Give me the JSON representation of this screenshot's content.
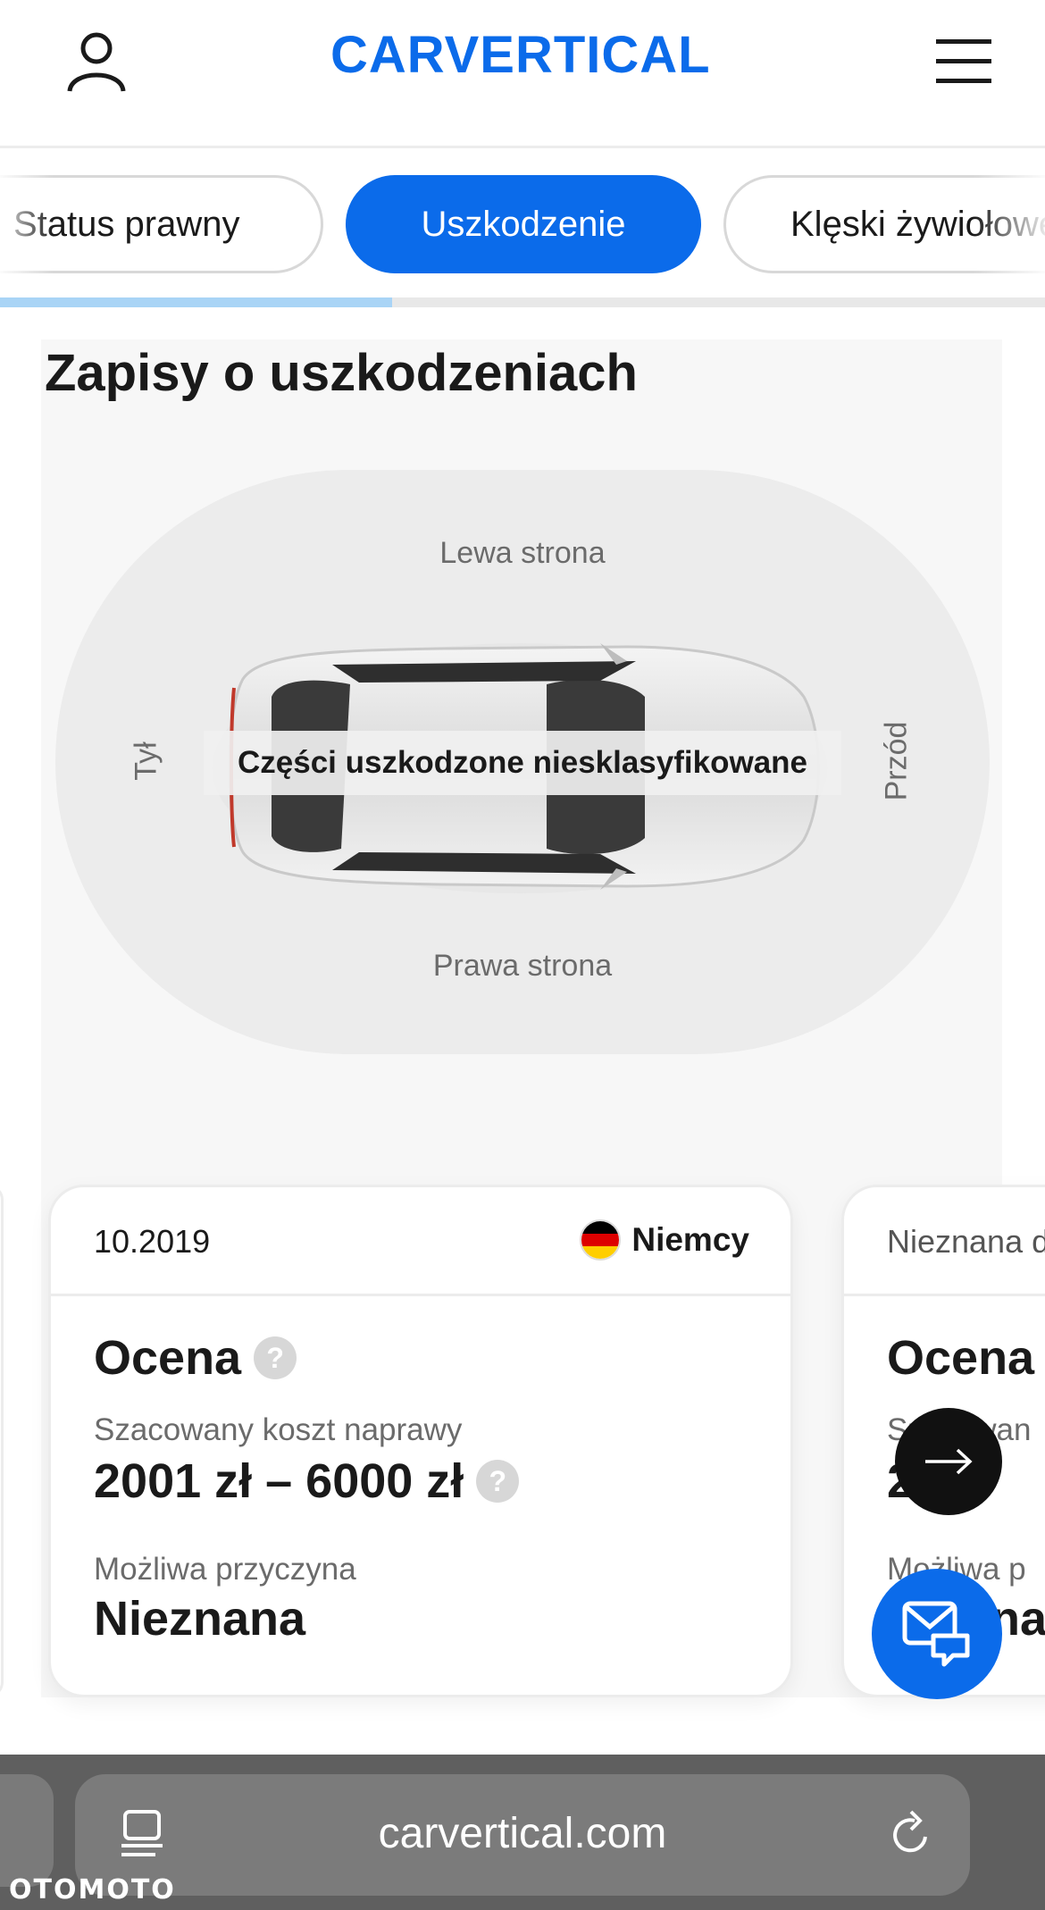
{
  "header": {
    "logo_text": "CARVERTICAL",
    "brand_color": "#0b6bea"
  },
  "tabs": {
    "items": [
      {
        "label": "Status prawny",
        "active": false
      },
      {
        "label": "Uszkodzenie",
        "active": true
      },
      {
        "label": "Klęski żywiołowe",
        "active": false
      }
    ],
    "progress_fraction": 0.375
  },
  "section": {
    "title": "Zapisy o uszkodzeniach",
    "diagram": {
      "left_side": "Lewa strona",
      "right_side": "Prawa strona",
      "rear": "Tył",
      "front": "Przód",
      "damage_label": "Części uszkodzone niesklasyfikowane"
    }
  },
  "cards": [
    {
      "date": "10.2019",
      "country": "Niemcy",
      "flag_colors": [
        "#000000",
        "#dd0000",
        "#ffce00"
      ],
      "rating_title": "Ocena",
      "cost_label": "Szacowany koszt naprawy",
      "cost_value": "2001 zł – 6000 zł",
      "cause_label": "Możliwa przyczyna",
      "cause_value": "Nieznana"
    },
    {
      "date": "Nieznana d",
      "rating_title": "Ocena",
      "cost_label": "Szacowan",
      "cost_value": "2",
      "cause_label": "Możliwa p",
      "cause_value": "na"
    }
  ],
  "help_symbol": "?",
  "browser": {
    "url": "carvertical.com"
  },
  "watermark": "OTOMOTO"
}
